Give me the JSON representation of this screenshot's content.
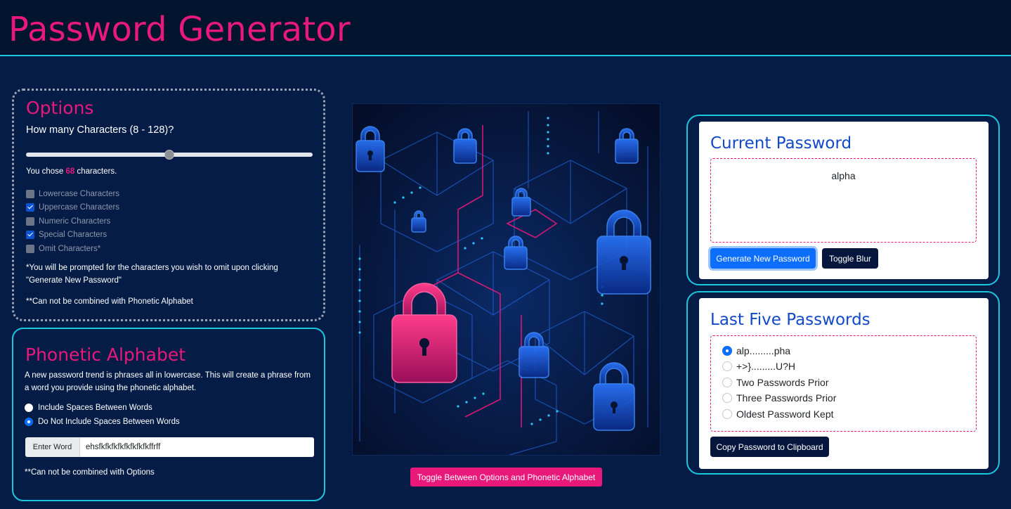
{
  "header": {
    "title": "Password Generator"
  },
  "options": {
    "title": "Options",
    "question": "How many Characters (8 - 128)?",
    "slider_value": 68,
    "slider_min": 8,
    "slider_max": 128,
    "chose_prefix": "You chose ",
    "chose_value": "68",
    "chose_suffix": " characters.",
    "checkboxes": [
      {
        "label": "Lowercase Characters",
        "checked": false
      },
      {
        "label": "Uppercase Characters",
        "checked": true
      },
      {
        "label": "Numeric Characters",
        "checked": false
      },
      {
        "label": "Special Characters",
        "checked": true
      },
      {
        "label": "Omit Characters*",
        "checked": false
      }
    ],
    "note_omit": "*You will be prompted for the characters you wish to omit upon clicking \"Generate New Password\"",
    "note_combine": "**Can not be combined with Phonetic Alphabet"
  },
  "phonetic": {
    "title": "Phonetic Alphabet",
    "description": "A new password trend is phrases all in lowercase. This will create a phrase from a word you provide using the phonetic alphabet.",
    "radios": [
      {
        "label": "Include Spaces Between Words",
        "checked": false
      },
      {
        "label": "Do Not Include Spaces Between Words",
        "checked": true
      }
    ],
    "input_label": "Enter Word",
    "input_value": "ehsfkfkfkfkfkfkfkfkffrff",
    "note": "**Can not be combined with Options"
  },
  "image": {
    "toggle_label": "Toggle Between Options and Phonetic Alphabet"
  },
  "current": {
    "title": "Current Password",
    "password": "alpha",
    "generate_label": "Generate New Password",
    "blur_label": "Toggle Blur"
  },
  "history": {
    "title": "Last Five Passwords",
    "items": [
      {
        "label": "alp.........pha",
        "selected": true
      },
      {
        "label": "+>}.........U?H",
        "selected": false
      },
      {
        "label": "Two Passwords Prior",
        "selected": false
      },
      {
        "label": "Three Passwords Prior",
        "selected": false
      },
      {
        "label": "Oldest Password Kept",
        "selected": false
      }
    ],
    "copy_label": "Copy Password to Clipboard"
  },
  "colors": {
    "background": "#051c46",
    "accent_pink": "#e8197a",
    "accent_cyan": "#1cc7e0",
    "title_blue": "#1149c9"
  }
}
